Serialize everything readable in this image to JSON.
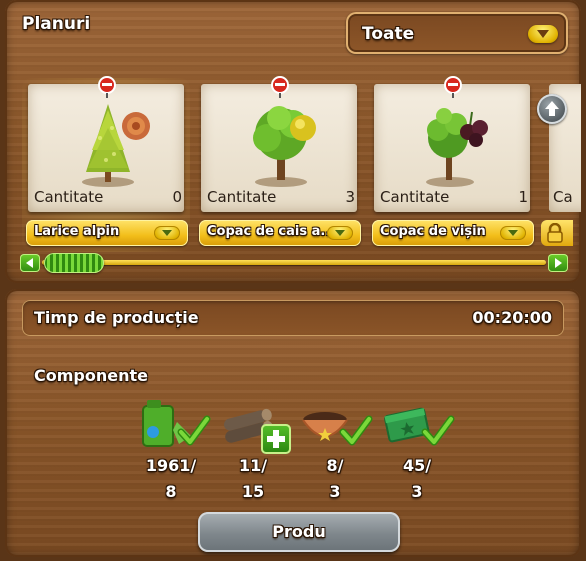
{
  "header": {
    "title": "Planuri",
    "filter": {
      "selected": "Toate",
      "icon": "chevron-down-icon"
    }
  },
  "plans": [
    {
      "name": "Larice alpin",
      "qty_label": "Cantitate",
      "qty": "0",
      "icon": "alpine-larch-icon",
      "selected": true
    },
    {
      "name": "Copac de cais a...",
      "qty_label": "Cantitate",
      "qty": "3",
      "icon": "apricot-tree-icon"
    },
    {
      "name": "Copac de vișin",
      "qty_label": "Cantitate",
      "qty": "1",
      "icon": "cherry-tree-icon"
    },
    {
      "name": "",
      "qty_label": "Ca",
      "qty": "",
      "icon": "lock-icon",
      "locked": true
    }
  ],
  "production": {
    "time_label": "Timp de producție",
    "time_value": "00:20:00"
  },
  "components": {
    "title": "Componente",
    "items": [
      {
        "have": "1961/",
        "need": "8",
        "icon": "watering-can-icon",
        "status": "check"
      },
      {
        "have": "11/",
        "need": "15",
        "icon": "wood-logs-icon",
        "status": "add"
      },
      {
        "have": "8/",
        "need": "3",
        "icon": "soil-bowl-icon",
        "status": "check"
      },
      {
        "have": "45/",
        "need": "3",
        "icon": "fertilizer-pack-icon",
        "status": "check"
      }
    ]
  },
  "actions": {
    "produce_label": "Produ"
  },
  "colors": {
    "gold": "#f2be1a",
    "green": "#3fa51a",
    "wood": "#8a5629",
    "paper": "#efe6d4"
  }
}
